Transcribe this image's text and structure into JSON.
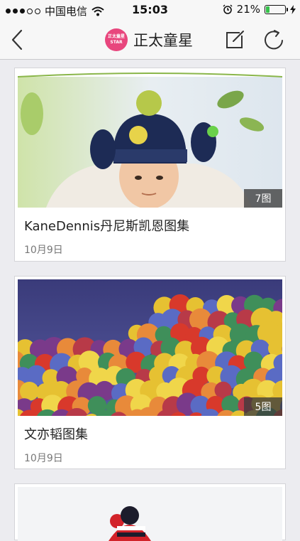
{
  "status_bar": {
    "carrier": "中国电信",
    "time": "15:03",
    "battery": "21%",
    "battery_level": 0.21
  },
  "nav": {
    "logo_line1": "正太童星",
    "logo_line2": "STAR",
    "title": "正太童星",
    "icons": [
      "back-chevron-icon",
      "edit-icon",
      "refresh-icon"
    ]
  },
  "albums": [
    {
      "title": "KaneDennis丹尼斯凯恩图集",
      "date": "10月9日",
      "count": "7图"
    },
    {
      "title": "文亦韬图集",
      "date": "10月9日",
      "count": "5图"
    }
  ],
  "colors": {
    "logo": "#e8467d",
    "battery_fill": "#35c24a"
  }
}
